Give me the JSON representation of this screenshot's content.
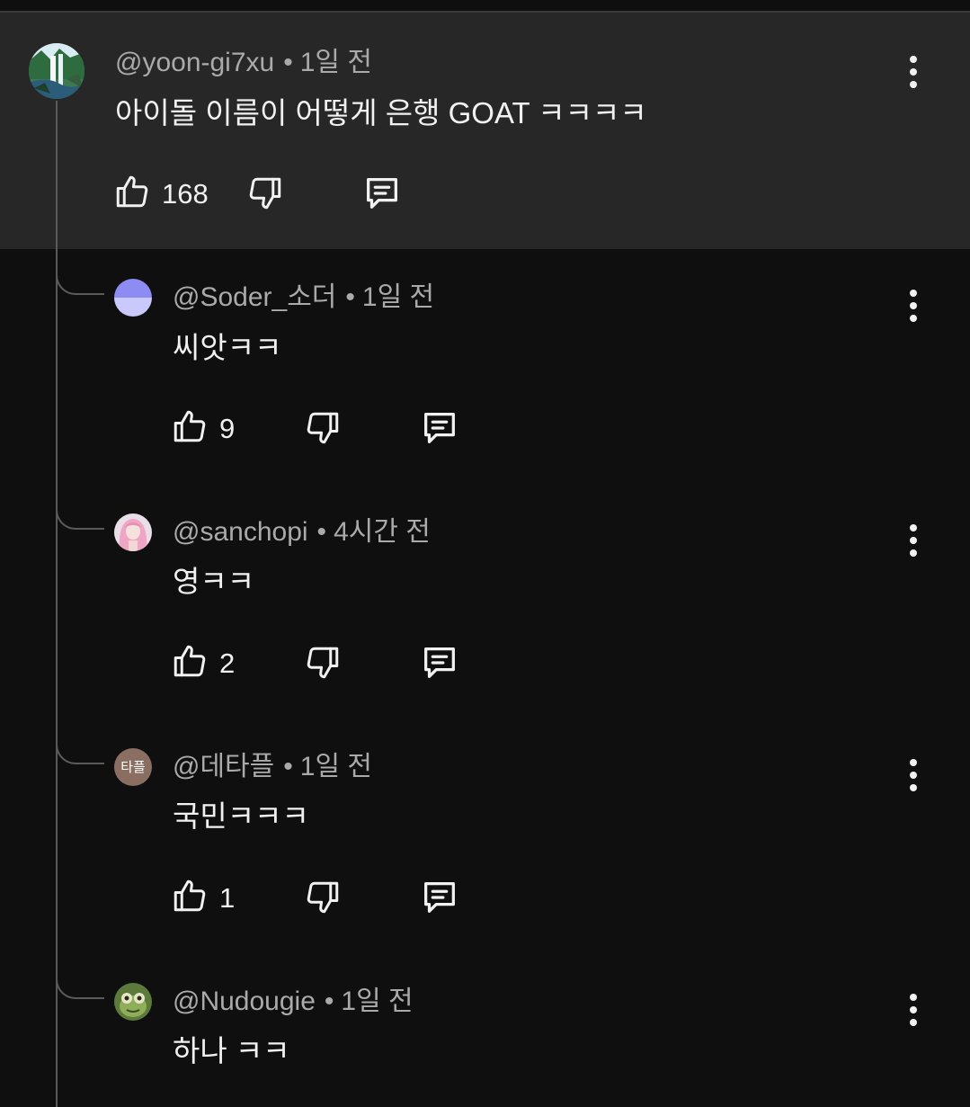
{
  "comments": [
    {
      "handle": "@yoon-gi7xu",
      "sep": "•",
      "time": "1일 전",
      "text": "아이돌 이름이 어떻게 은행 GOAT ㅋㅋㅋㅋ",
      "likes": "168",
      "avatar_icon": "waterfall-landscape-avatar"
    },
    {
      "handle": "@Soder_소더",
      "sep": "•",
      "time": "1일 전",
      "text": "씨앗ㅋㅋ",
      "likes": "9",
      "avatar_icon": "purple-gradient-avatar"
    },
    {
      "handle": "@sanchopi",
      "sep": "•",
      "time": "4시간 전",
      "text": "영ㅋㅋ",
      "likes": "2",
      "avatar_icon": "pink-hair-character-avatar"
    },
    {
      "handle": "@데타플",
      "sep": "•",
      "time": "1일 전",
      "text": "국민ㅋㅋㅋ",
      "likes": "1",
      "avatar_icon": "text-avatar",
      "avatar_text": "타플"
    },
    {
      "handle": "@Nudougie",
      "sep": "•",
      "time": "1일 전",
      "text": "하나 ㅋㅋ",
      "avatar_icon": "green-frog-avatar"
    }
  ],
  "colors": {
    "background": "#0f0f0f",
    "highlight": "#272727",
    "thread_line": "#5a5a5a",
    "meta_text": "#aaaaaa",
    "primary_text": "#f1f1f1"
  }
}
